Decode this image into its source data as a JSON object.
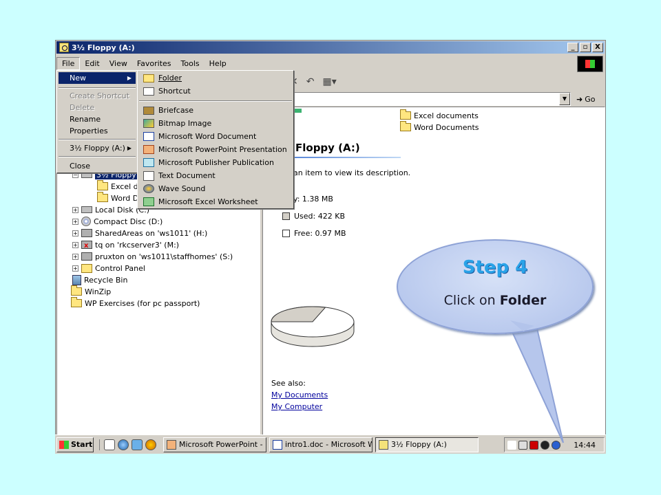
{
  "window": {
    "title": "3½ Floppy (A:)",
    "controls": {
      "minimize": "_",
      "restore": "▫",
      "close": "X"
    }
  },
  "menubar": [
    "File",
    "Edit",
    "View",
    "Favorites",
    "Tools",
    "Help"
  ],
  "address": {
    "value": "",
    "go_label": "Go"
  },
  "file_menu": {
    "items": [
      {
        "label": "New",
        "disabled": false,
        "submenu": true
      },
      {
        "label": "Create Shortcut",
        "disabled": true
      },
      {
        "label": "Delete",
        "disabled": true
      },
      {
        "label": "Rename",
        "disabled": false
      },
      {
        "label": "Properties",
        "disabled": false
      },
      {
        "label": "3½ Floppy (A:)",
        "disabled": false,
        "submenu": true
      },
      {
        "label": "Close",
        "disabled": false
      }
    ]
  },
  "new_submenu": {
    "items": [
      {
        "label": "Folder",
        "icon": "folder-icon"
      },
      {
        "label": "Shortcut",
        "icon": "shortcut-icon"
      },
      {
        "label": "Briefcase",
        "icon": "briefcase-icon"
      },
      {
        "label": "Bitmap Image",
        "icon": "bitmap-icon"
      },
      {
        "label": "Microsoft Word Document",
        "icon": "word-icon"
      },
      {
        "label": "Microsoft PowerPoint Presentation",
        "icon": "powerpoint-icon"
      },
      {
        "label": "Microsoft Publisher Publication",
        "icon": "publisher-icon"
      },
      {
        "label": "Text Document",
        "icon": "text-document-icon"
      },
      {
        "label": "Wave Sound",
        "icon": "wave-sound-icon"
      },
      {
        "label": "Microsoft Excel Worksheet",
        "icon": "excel-icon"
      }
    ]
  },
  "tree": {
    "items": [
      {
        "label": "3½ Floppy"
      },
      {
        "label": "Excel dc"
      },
      {
        "label": "Word Do"
      },
      {
        "label": "Local Disk (C:)"
      },
      {
        "label": "Compact Disc (D:)"
      },
      {
        "label": "SharedAreas on 'ws1011' (H:)"
      },
      {
        "label": "tq on 'rkcserver3' (M:)"
      },
      {
        "label": "pruxton on 'ws1011\\staffhomes' (S:)"
      },
      {
        "label": "Control Panel"
      },
      {
        "label": "Recycle Bin"
      },
      {
        "label": "WinZip"
      },
      {
        "label": "WP Exercises (for pc passport)"
      }
    ]
  },
  "content": {
    "folders": [
      "Excel documents",
      "Word Documents"
    ],
    "heading": "Floppy (A:)",
    "description": "an item to view its description.",
    "capacity": "y: 1.38 MB",
    "used": "Used: 422 KB",
    "free": "Free: 0.97 MB",
    "used_fraction": 0.3,
    "see_also": "See also:",
    "links": [
      "My Documents",
      "My Computer"
    ],
    "colors": {
      "used": "#d4d0c8",
      "free": "#ffffff"
    }
  },
  "taskbar": {
    "start": "Start",
    "tasks": [
      {
        "label": "Microsoft PowerPoint - [...",
        "icon": "powerpoint-icon",
        "active": false
      },
      {
        "label": "intro1.doc - Microsoft W...",
        "icon": "word-icon",
        "active": false
      },
      {
        "label": "3½ Floppy (A:)",
        "icon": "explorer-icon",
        "active": true
      }
    ],
    "clock": "14:44"
  },
  "callout": {
    "title": "Step 4",
    "text_prefix": "Click on ",
    "text_bold": "Folder"
  }
}
